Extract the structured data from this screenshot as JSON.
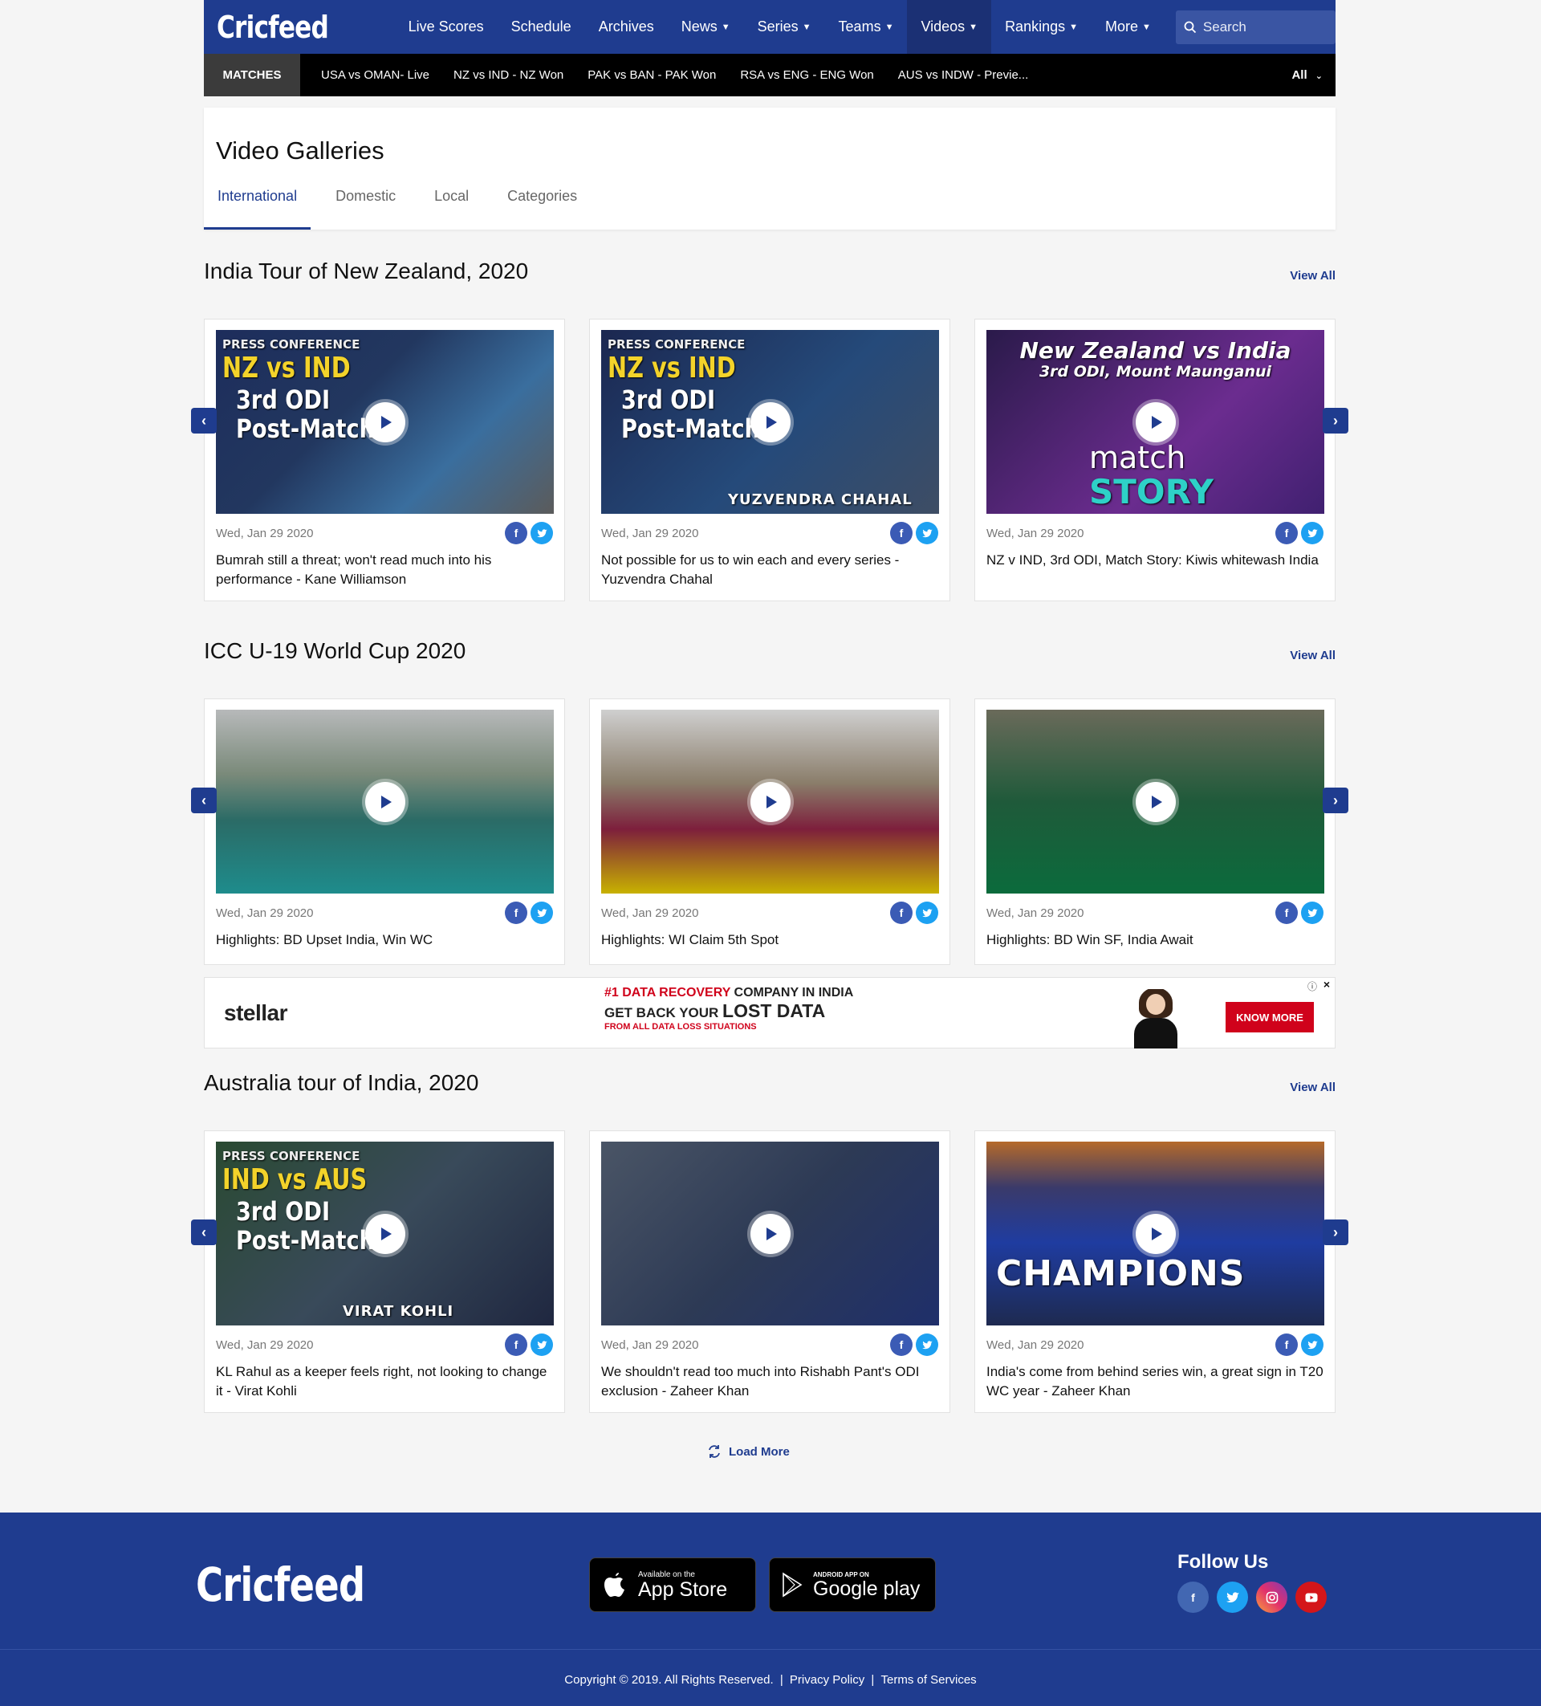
{
  "brand": "Cricfeed",
  "nav": [
    {
      "label": "Live Scores",
      "chev": false,
      "active": false
    },
    {
      "label": "Schedule",
      "chev": false,
      "active": false
    },
    {
      "label": "Archives",
      "chev": false,
      "active": false
    },
    {
      "label": "News",
      "chev": true,
      "active": false
    },
    {
      "label": "Series",
      "chev": true,
      "active": false
    },
    {
      "label": "Teams",
      "chev": true,
      "active": false
    },
    {
      "label": "Videos",
      "chev": true,
      "active": true
    },
    {
      "label": "Rankings",
      "chev": true,
      "active": false
    },
    {
      "label": "More",
      "chev": true,
      "active": false
    }
  ],
  "search": {
    "placeholder": "Search"
  },
  "matchbar": {
    "label": "MATCHES",
    "matches": [
      "USA vs OMAN- Live",
      "NZ vs IND - NZ Won",
      "PAK vs BAN - PAK Won",
      "RSA vs  ENG - ENG Won",
      "AUS vs INDW - Previe..."
    ],
    "filter": "All"
  },
  "page_title": "Video Galleries",
  "tabs": [
    "International",
    "Domestic",
    "Local",
    "Categories"
  ],
  "sections": [
    {
      "title": "India Tour of New Zealand, 2020",
      "view_all": "View All",
      "cards": [
        {
          "date": "Wed, Jan 29 2020",
          "caption": "Bumrah still a threat; won't read much into his performance - Kane Williamson",
          "thumb_lines": [
            "PRESS CONFERENCE",
            "NZ vs IND",
            "3rd ODI",
            "Post-Match"
          ]
        },
        {
          "date": "Wed, Jan 29 2020",
          "caption": "Not possible for us to win each and every series - Yuzvendra Chahal",
          "thumb_lines": [
            "PRESS CONFERENCE",
            "NZ vs IND",
            "3rd ODI",
            "Post-Match",
            "YUZVENDRA CHAHAL"
          ]
        },
        {
          "date": "Wed, Jan 29 2020",
          "caption": "NZ v IND, 3rd ODI, Match Story: Kiwis whitewash India",
          "thumb_lines": [
            "New Zealand vs India",
            "3rd ODI, Mount Maunganui",
            "match",
            "STORY"
          ]
        }
      ]
    },
    {
      "title": "ICC U-19 World Cup 2020",
      "view_all": "View All",
      "cards": [
        {
          "date": "Wed, Jan 29 2020",
          "caption": "Highlights: BD Upset India, Win WC",
          "thumb_lines": []
        },
        {
          "date": "Wed, Jan 29 2020",
          "caption": "Highlights: WI Claim 5th Spot",
          "thumb_lines": []
        },
        {
          "date": "Wed, Jan 29 2020",
          "caption": "Highlights: BD Win SF, India Await",
          "thumb_lines": []
        }
      ]
    },
    {
      "title": "Australia tour of India, 2020",
      "view_all": "View All",
      "cards": [
        {
          "date": "Wed, Jan 29 2020",
          "caption": "KL Rahul as a keeper feels right, not looking to change it - Virat Kohli",
          "thumb_lines": [
            "PRESS CONFERENCE",
            "IND vs AUS",
            "3rd ODI",
            "Post-Match",
            "VIRAT KOHLI"
          ]
        },
        {
          "date": "Wed, Jan 29 2020",
          "caption": "We shouldn't read too much into Rishabh Pant's ODI exclusion - Zaheer Khan",
          "thumb_lines": []
        },
        {
          "date": "Wed, Jan 29 2020",
          "caption": "India's come from behind series win, a great sign in T20 WC year - Zaheer Khan",
          "thumb_lines": [
            "CHAMPIONS"
          ]
        }
      ]
    }
  ],
  "ad": {
    "brand": "stellar",
    "line1_red": "#1 DATA RECOVERY",
    "line1_black": " COMPANY IN INDIA",
    "line2_black": "GET BACK YOUR ",
    "line2_big": "LOST DATA",
    "line3": "FROM ALL DATA LOSS SITUATIONS",
    "cta": "KNOW MORE"
  },
  "load_more": "Load More",
  "footer": {
    "brand": "Cricfeed",
    "appstore_small": "Available on the",
    "appstore_big": "App Store",
    "play_small": "ANDROID APP ON",
    "play_big": "Google play",
    "follow": "Follow Us",
    "copyright": "Copyright © 2019. All Rights Reserved.",
    "privacy": "Privacy Policy",
    "terms": "Terms of Services"
  },
  "colors": {
    "primary": "#1f3c8f",
    "nav_active": "#1b3074",
    "facebook": "#3b5bb5",
    "twitter": "#1da1f2",
    "ad_red": "#d0021b"
  }
}
